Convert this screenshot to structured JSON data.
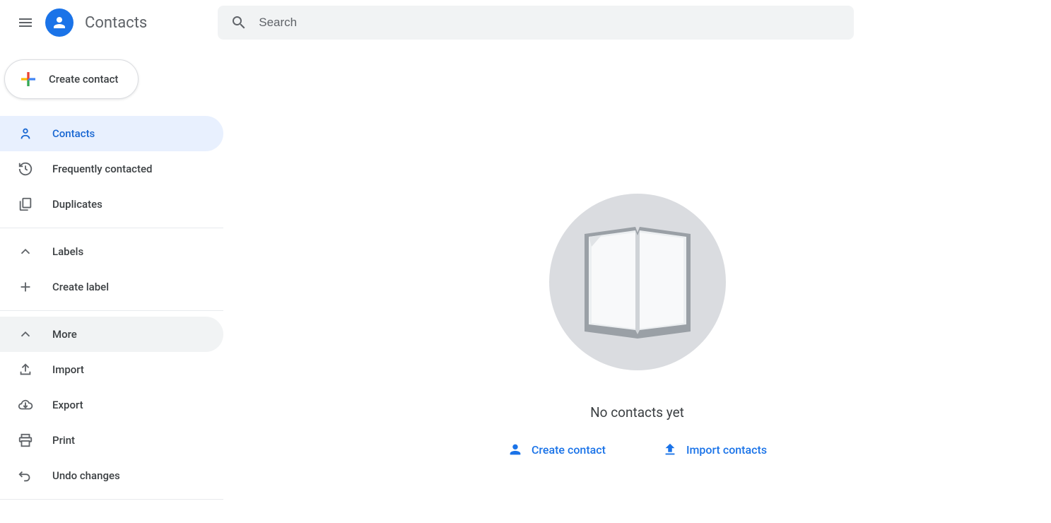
{
  "header": {
    "app_title": "Contacts",
    "search_placeholder": "Search"
  },
  "sidebar": {
    "create_contact_label": "Create contact",
    "items": {
      "contacts": "Contacts",
      "frequently": "Frequently contacted",
      "duplicates": "Duplicates",
      "labels": "Labels",
      "create_label": "Create label",
      "more": "More",
      "import": "Import",
      "export": "Export",
      "print": "Print",
      "undo": "Undo changes"
    }
  },
  "main": {
    "empty_text": "No contacts yet",
    "create_contact_label": "Create contact",
    "import_contacts_label": "Import contacts"
  }
}
